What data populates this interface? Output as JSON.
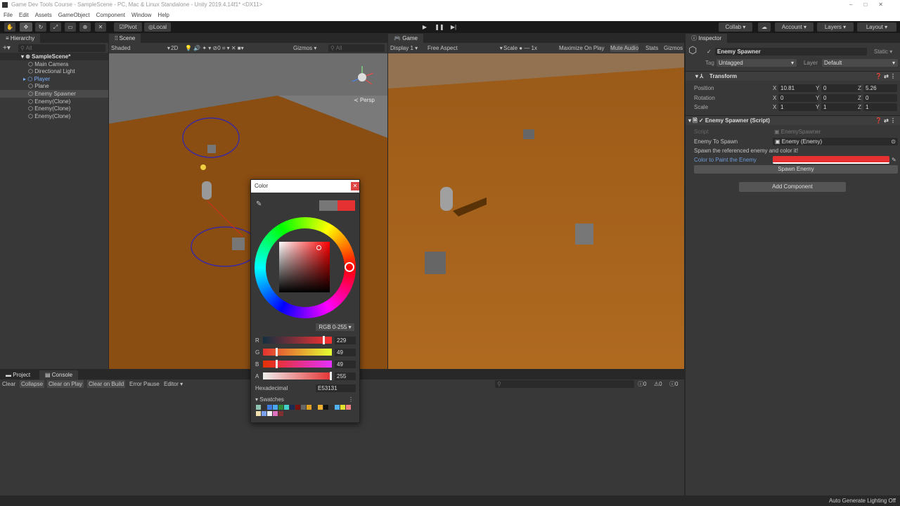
{
  "window": {
    "title": "Game Dev Tools Course - SampleScene - PC, Mac & Linux Standalone - Unity 2019.4.14f1* <DX11>"
  },
  "menu": [
    "File",
    "Edit",
    "Assets",
    "GameObject",
    "Component",
    "Window",
    "Help"
  ],
  "toolbar": {
    "pivot": "Pivot",
    "local": "Local",
    "collab": "Collab ▾",
    "account": "Account",
    "layers": "Layers",
    "layout": "Layout"
  },
  "hierarchy": {
    "title": "Hierarchy",
    "search_placeholder": "All",
    "scene": "SampleScene*",
    "items": [
      "Main Camera",
      "Directional Light",
      "Player",
      "Plane",
      "Enemy Spawner",
      "Enemy(Clone)",
      "Enemy(Clone)",
      "Enemy(Clone)"
    ]
  },
  "scene": {
    "title": "Scene",
    "shading": "Shaded",
    "mode2d": "2D",
    "gizmos": "Gizmos",
    "search_placeholder": "All",
    "persp": "Persp",
    "fx_count": "0"
  },
  "game": {
    "title": "Game",
    "display": "Display 1",
    "aspect": "Free Aspect",
    "scale_label": "Scale",
    "scale": "1x",
    "maximize": "Maximize On Play",
    "mute": "Mute Audio",
    "stats": "Stats",
    "gizmos": "Gizmos"
  },
  "inspector": {
    "title": "Inspector",
    "object_name": "Enemy Spawner",
    "static": "Static",
    "tag_label": "Tag",
    "tag": "Untagged",
    "layer_label": "Layer",
    "layer": "Default",
    "transform": {
      "title": "Transform",
      "rows": [
        {
          "label": "Position",
          "x": "10.81",
          "y": "0",
          "z": "5.26"
        },
        {
          "label": "Rotation",
          "x": "0",
          "y": "0",
          "z": "0"
        },
        {
          "label": "Scale",
          "x": "1",
          "y": "1",
          "z": "1"
        }
      ]
    },
    "script": {
      "title": "Enemy Spawner (Script)",
      "script_label": "Script",
      "script_value": "EnemySpawner",
      "enemy_label": "Enemy To Spawn",
      "enemy_value": "Enemy (Enemy)",
      "info": "Spawn the referenced enemy and color it!",
      "color_label": "Color to Paint the Enemy",
      "color": "#E53131",
      "spawn_button": "Spawn Enemy"
    },
    "add_component": "Add Component"
  },
  "console": {
    "tab_project": "Project",
    "tab_console": "Console",
    "buttons": [
      "Clear",
      "Collapse",
      "Clear on Play",
      "Clear on Build",
      "Error Pause",
      "Editor ▾"
    ],
    "counts": [
      "0",
      "0",
      "0"
    ]
  },
  "color_picker": {
    "title": "Color",
    "mode": "RGB 0-255 ▾",
    "r": "229",
    "g": "49",
    "b": "49",
    "a": "255",
    "r_frac": 0.898,
    "g_frac": 0.192,
    "b_frac": 0.192,
    "a_frac": 1.0,
    "hex_label": "Hexadecimal",
    "hex": "E53131",
    "swatches_label": "Swatches",
    "swatches": [
      "#8fc4b4",
      "#333333",
      "#3e7be0",
      "#4aa8f0",
      "#2e8b3a",
      "#42d0c8",
      "#1a2a50",
      "#7a1010",
      "#666666",
      "#e0a020",
      "#333333",
      "#f0b030",
      "#111111",
      "#333333",
      "#50b0f0",
      "#e0e030",
      "#f08080",
      "#f0e0b0",
      "#7aa0f0",
      "#f0f0f0",
      "#e070c0",
      "#803030"
    ]
  },
  "status": {
    "text": "Auto Generate Lighting Off"
  }
}
